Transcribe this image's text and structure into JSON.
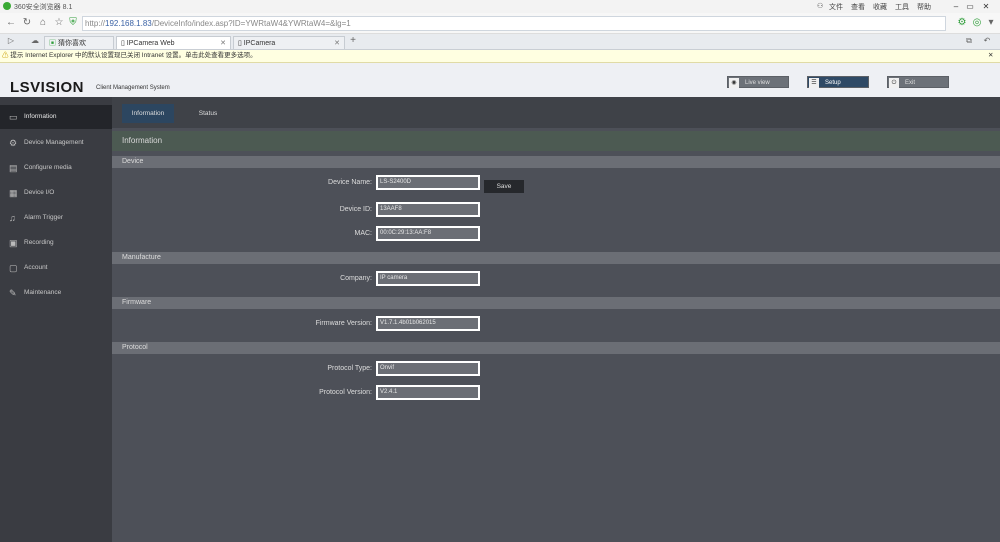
{
  "browser": {
    "window_title": "360安全浏览器 8.1",
    "menu": [
      "文件",
      "查看",
      "收藏",
      "工具",
      "帮助"
    ],
    "url_scheme": "http://",
    "url_host": "192.168.1.83",
    "url_path": "/DeviceInfo/index.asp?ID=YWRtaW4&YWRtaW4=&lg=1",
    "tabs": [
      {
        "label": "猜你喜欢"
      },
      {
        "label": "IPCamera Web"
      },
      {
        "label": "IPCamera"
      }
    ],
    "infobar": "提示 Internet Explorer 中的默认设置现已关闭 Intranet 设置。单击此处查看更多选项。"
  },
  "header": {
    "brand": "LSVISION",
    "subtitle": "Client Management System",
    "buttons": [
      {
        "label": "Live view",
        "icon": "camera-icon"
      },
      {
        "label": "Setup",
        "icon": "list-icon"
      },
      {
        "label": "Exit",
        "icon": "power-icon"
      }
    ]
  },
  "sidebar": {
    "items": [
      {
        "label": "Information",
        "icon": "monitor-icon"
      },
      {
        "label": "Device Management",
        "icon": "gear-icon"
      },
      {
        "label": "Configure media",
        "icon": "calendar-icon"
      },
      {
        "label": "Device I/O",
        "icon": "io-icon"
      },
      {
        "label": "Alarm Trigger",
        "icon": "bell-icon"
      },
      {
        "label": "Recording",
        "icon": "film-icon"
      },
      {
        "label": "Account",
        "icon": "account-icon"
      },
      {
        "label": "Maintenance",
        "icon": "wrench-icon"
      }
    ]
  },
  "main": {
    "tabs": [
      "Information",
      "Status"
    ],
    "section_title": "Information",
    "groups": {
      "device": "Device",
      "manufacture": "Manufacture",
      "firmware": "Firmware",
      "protocol": "Protocol"
    },
    "fields": {
      "device_name": {
        "label": "Device Name:",
        "value": "LS-S2400D"
      },
      "device_id": {
        "label": "Device ID:",
        "value": "13AAF8"
      },
      "mac": {
        "label": "MAC:",
        "value": "00:0C:29:13:AA:F8"
      },
      "company": {
        "label": "Company:",
        "value": "IP camera"
      },
      "firmware_version": {
        "label": "Firmware Version:",
        "value": "V1.7.1.4b01b062015"
      },
      "protocol_type": {
        "label": "Protocol Type:",
        "value": "Onvif"
      },
      "protocol_version": {
        "label": "Protocol Version:",
        "value": "V2.4.1"
      }
    },
    "save_label": "Save"
  }
}
